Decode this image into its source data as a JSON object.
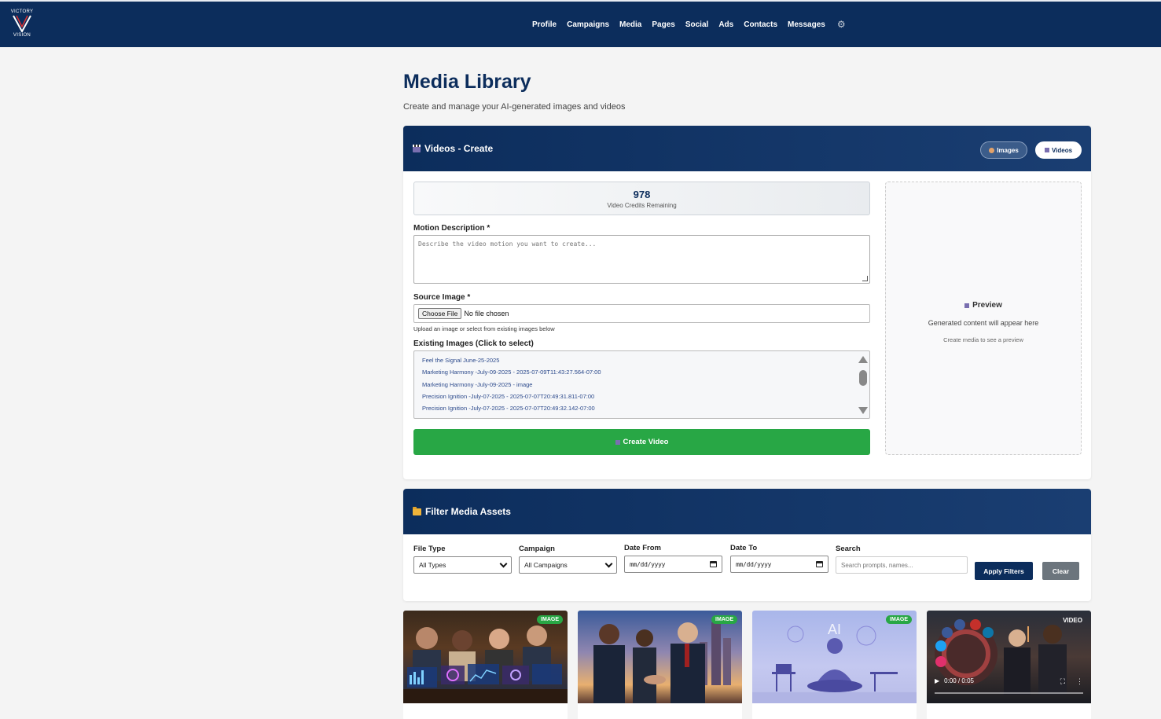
{
  "brand": {
    "line1": "VICTORY",
    "line2": "VISION"
  },
  "nav": [
    "Profile",
    "Campaigns",
    "Media",
    "Pages",
    "Social",
    "Ads",
    "Contacts",
    "Messages"
  ],
  "page": {
    "title": "Media Library",
    "subtitle": "Create and manage your AI-generated images and videos"
  },
  "create_card": {
    "title": "Videos - Create",
    "toggle_images": "Images",
    "toggle_videos": "Videos",
    "credits_value": "978",
    "credits_label": "Video Credits Remaining",
    "motion_label": "Motion Description *",
    "motion_placeholder": "Describe the video motion you want to create...",
    "source_label": "Source Image *",
    "choose_file": "Choose File",
    "no_file": "No file chosen",
    "upload_hint": "Upload an image or select from existing images below",
    "existing_label": "Existing Images (Click to select)",
    "existing_images": [
      "Feel the Signal June-25-2025",
      "Marketing Harmony -July-09-2025 - 2025-07-09T11:43:27.564-07:00",
      "Marketing Harmony -July-09-2025 - image",
      "Precision Ignition -July-07-2025 - 2025-07-07T20:49:31.811-07:00",
      "Precision Ignition -July-07-2025 - 2025-07-07T20:49:32.142-07:00"
    ],
    "create_button": "Create Video",
    "preview_title": "Preview",
    "preview_text": "Generated content will appear here",
    "preview_sub": "Create media to see a preview"
  },
  "filter_card": {
    "title": "Filter Media Assets",
    "file_type_label": "File Type",
    "file_type_value": "All Types",
    "campaign_label": "Campaign",
    "campaign_value": "All Campaigns",
    "date_from_label": "Date From",
    "date_from_value": "mm/dd/yyyy",
    "date_to_label": "Date To",
    "date_to_value": "mm/dd/yyyy",
    "search_label": "Search",
    "search_placeholder": "Search prompts, names...",
    "apply_button": "Apply Filters",
    "clear_button": "Clear"
  },
  "media_items": [
    {
      "badge": "IMAGE"
    },
    {
      "badge": "IMAGE"
    },
    {
      "badge": "IMAGE"
    },
    {
      "badge": "VIDEO",
      "time": "0:00 / 0:05"
    }
  ],
  "colors": {
    "navy": "#0c2d5c",
    "green": "#28a745",
    "gray": "#6c757d"
  }
}
